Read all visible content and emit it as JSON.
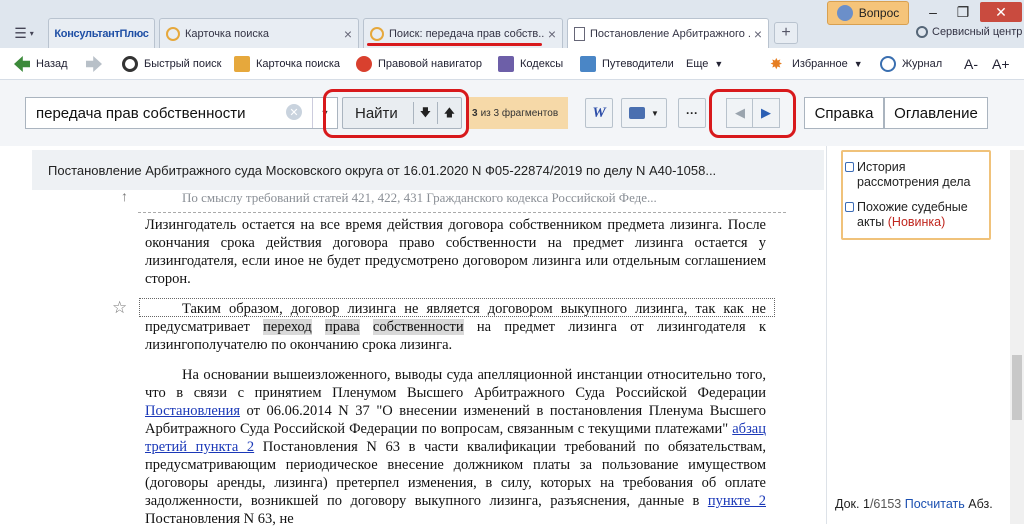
{
  "tabs": {
    "logo": "КонсультантПлюс",
    "tab1": "Карточка поиска",
    "tab2": "Поиск: передача прав собств...",
    "tab3": "Постановление Арбитражного ...",
    "help_label": "Вопрос",
    "service_label": "Сервисный центр"
  },
  "toolbar": {
    "back": "Назад",
    "quick_search": "Быстрый поиск",
    "search_card": "Карточка поиска",
    "legal_nav": "Правовой навигатор",
    "codes": "Кодексы",
    "guides": "Путеводители",
    "more": "Еще",
    "favorites": "Избранное",
    "journal": "Журнал",
    "font_smaller": "A-",
    "font_bigger": "A+"
  },
  "search": {
    "query": "передача прав собственности",
    "find_label": "Найти",
    "fragments_count": "3",
    "fragments_text": "из 3 фрагментов",
    "word_label": "W",
    "reference_label": "Справка",
    "contents_label": "Оглавление"
  },
  "document": {
    "title": "Постановление Арбитражного суда Московского округа от 16.01.2020 N Ф05-22874/2019 по делу N А40-1058...",
    "prev_line": "По смыслу требований статей 421, 422, 431 Гражданского кодекса Российской Феде...",
    "p1": "Лизингодатель остается на все время действия договора собственником предмета лизинга. После окончания срока действия договора право собственности на предмет лизинга остается у лизингодателя, если иное не будет предусмотрено договором лизинга или отдельным соглашением сторон.",
    "p2_start": "Таким образом, договор лизинга не является договором выкупного лизинга, так как не предусматривает ",
    "p2_hl1": "переход",
    "p2_hl2": "права",
    "p2_hl3": "собственности",
    "p2_end": " на предмет лизинга от лизингодателя к лизингополучателю по окончанию срока лизинга.",
    "p3_a": "На основании вышеизложенного, выводы суда апелляционной инстанции относительно того, что в связи с принятием Пленумом Высшего Арбитражного Суда Российской Федерации ",
    "p3_link1": "Постановления",
    "p3_b": " от 06.06.2014 N 37 \"О внесении изменений в постановления Пленума Высшего Арбитражного Суда Российской Федерации по вопросам, связанным с текущими платежами\" ",
    "p3_link2": "абзац третий пункта 2",
    "p3_c": " Постановления N 63 в части квалификации требований по обязательствам, предусматривающим периодическое внесение должником платы за пользование имуществом (договоры аренды, лизинга) претерпел изменения, в силу, которых на требования об оплате задолженности, возникшей по договору выкупного лизинга, разъяснения, данные в ",
    "p3_link3": "пункте 2",
    "p3_d": " Постановления N 63, не"
  },
  "right_panel": {
    "history": "История рассмотрения дела",
    "similar": "Похожие судебные акты",
    "new_tag": "(Новинка)"
  },
  "status": {
    "doc_prefix": "Док. 1",
    "doc_total": "/6153",
    "count_link": "Посчитать",
    "abz": "Абз."
  }
}
